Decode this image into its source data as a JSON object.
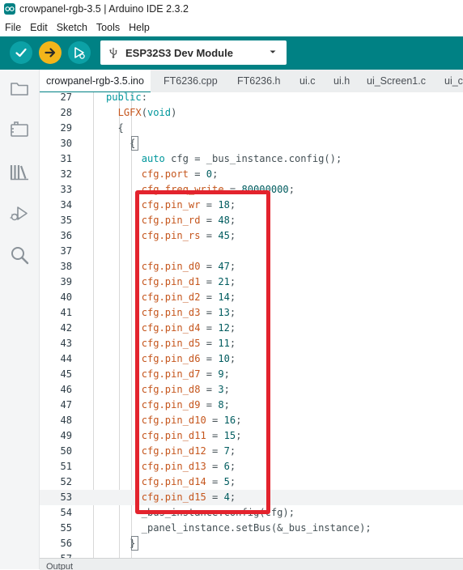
{
  "window": {
    "title": "crowpanel-rgb-3.5 | Arduino IDE 2.3.2"
  },
  "menu": [
    "File",
    "Edit",
    "Sketch",
    "Tools",
    "Help"
  ],
  "toolbar": {
    "board": "ESP32S3 Dev Module",
    "accent_color": "#008184",
    "verify_icon": "checkmark-icon",
    "upload_icon": "arrow-right-icon",
    "debug_icon": "debug-icon"
  },
  "sidebar": {
    "icons": [
      "folder-icon",
      "board-manager-icon",
      "library-icon",
      "debug-icon",
      "search-icon"
    ]
  },
  "tabs": [
    {
      "label": "crowpanel-rgb-3.5.ino",
      "active": true
    },
    {
      "label": "FT6236.cpp",
      "active": false
    },
    {
      "label": "FT6236.h",
      "active": false
    },
    {
      "label": "ui.c",
      "active": false
    },
    {
      "label": "ui.h",
      "active": false
    },
    {
      "label": "ui_Screen1.c",
      "active": false
    },
    {
      "label": "ui_c",
      "active": false
    }
  ],
  "editor": {
    "current_line": 53,
    "lines": [
      {
        "n": "27",
        "code": "public:"
      },
      {
        "n": "28",
        "code": "  LGFX(void)"
      },
      {
        "n": "29",
        "code": "  {"
      },
      {
        "n": "30",
        "code": "    {"
      },
      {
        "n": "31",
        "code": "      auto cfg = _bus_instance.config();"
      },
      {
        "n": "32",
        "code": "      cfg.port = 0;"
      },
      {
        "n": "33",
        "code": "      cfg.freq_write = 80000000;"
      },
      {
        "n": "34",
        "code": "      cfg.pin_wr = 18;"
      },
      {
        "n": "35",
        "code": "      cfg.pin_rd = 48;"
      },
      {
        "n": "36",
        "code": "      cfg.pin_rs = 45;"
      },
      {
        "n": "37",
        "code": ""
      },
      {
        "n": "38",
        "code": "      cfg.pin_d0 = 47;"
      },
      {
        "n": "39",
        "code": "      cfg.pin_d1 = 21;"
      },
      {
        "n": "40",
        "code": "      cfg.pin_d2 = 14;"
      },
      {
        "n": "41",
        "code": "      cfg.pin_d3 = 13;"
      },
      {
        "n": "42",
        "code": "      cfg.pin_d4 = 12;"
      },
      {
        "n": "43",
        "code": "      cfg.pin_d5 = 11;"
      },
      {
        "n": "44",
        "code": "      cfg.pin_d6 = 10;"
      },
      {
        "n": "45",
        "code": "      cfg.pin_d7 = 9;"
      },
      {
        "n": "46",
        "code": "      cfg.pin_d8 = 3;"
      },
      {
        "n": "47",
        "code": "      cfg.pin_d9 = 8;"
      },
      {
        "n": "48",
        "code": "      cfg.pin_d10 = 16;"
      },
      {
        "n": "49",
        "code": "      cfg.pin_d11 = 15;"
      },
      {
        "n": "50",
        "code": "      cfg.pin_d12 = 7;"
      },
      {
        "n": "51",
        "code": "      cfg.pin_d13 = 6;"
      },
      {
        "n": "52",
        "code": "      cfg.pin_d14 = 5;"
      },
      {
        "n": "53",
        "code": "      cfg.pin_d15 = 4;"
      },
      {
        "n": "54",
        "code": "      _bus_instance.config(cfg);"
      },
      {
        "n": "55",
        "code": "      _panel_instance.setBus(&_bus_instance);"
      },
      {
        "n": "56",
        "code": "    }"
      },
      {
        "n": "57",
        "code": ""
      }
    ]
  },
  "annotation": {
    "color": "#e3232d"
  },
  "bottom_panel": {
    "label": "Output"
  }
}
